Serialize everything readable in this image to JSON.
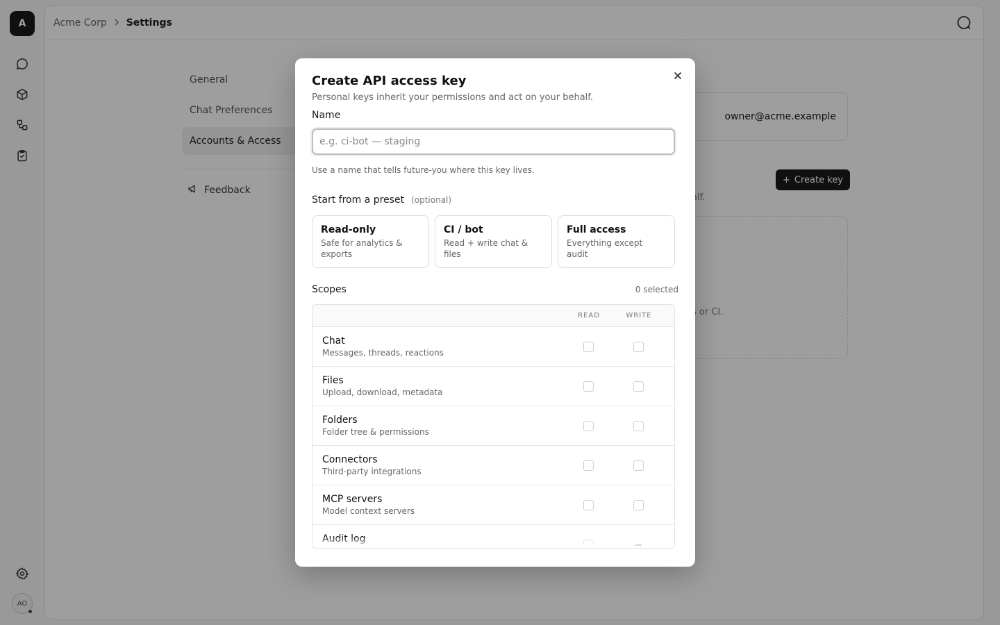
{
  "rail": {
    "logo_letter": "A",
    "nav_icons": [
      "chat-icon",
      "cube-icon",
      "connectors-icon",
      "clipboard-check-icon"
    ],
    "settings_icon": "gear-icon",
    "avatar_initials": "AO"
  },
  "topbar": {
    "breadcrumb_org": "Acme Corp",
    "breadcrumb_current": "Settings",
    "search_icon": "search-icon"
  },
  "settings_nav": {
    "items": [
      {
        "label": "General",
        "active": false
      },
      {
        "label": "Chat Preferences",
        "active": false
      },
      {
        "label": "Accounts & Access",
        "active": true
      }
    ],
    "feedback_label": "Feedback"
  },
  "background": {
    "owner_email": "owner@acme.example",
    "create_key_label": "Create key",
    "behalf_fragment": "alf.",
    "ci_fragment": "s or CI."
  },
  "modal": {
    "title": "Create API access key",
    "subtitle": "Personal keys inherit your permissions and act on your behalf.",
    "name_label": "Name",
    "name_placeholder": "e.g. ci-bot — staging",
    "name_value": "",
    "name_hint": "Use a name that tells future-you where this key lives.",
    "preset_label": "Start from a preset",
    "preset_optional": "(optional)",
    "presets": [
      {
        "title": "Read-only",
        "desc": "Safe for analytics & exports"
      },
      {
        "title": "CI / bot",
        "desc": "Read + write chat & files"
      },
      {
        "title": "Full access",
        "desc": "Everything except audit"
      }
    ],
    "scopes_label": "Scopes",
    "scopes_count": "0 selected",
    "col_read": "READ",
    "col_write": "WRITE",
    "scopes": [
      {
        "name": "Chat",
        "desc": "Messages, threads, reactions",
        "read": false,
        "write": false
      },
      {
        "name": "Files",
        "desc": "Upload, download, metadata",
        "read": false,
        "write": false
      },
      {
        "name": "Folders",
        "desc": "Folder tree & permissions",
        "read": false,
        "write": false
      },
      {
        "name": "Connectors",
        "desc": "Third-party integrations",
        "read": false,
        "write": false
      },
      {
        "name": "MCP servers",
        "desc": "Model context servers",
        "read": false,
        "write": false
      },
      {
        "name": "Audit log",
        "desc": "",
        "read": false,
        "write": "n/a"
      }
    ]
  }
}
